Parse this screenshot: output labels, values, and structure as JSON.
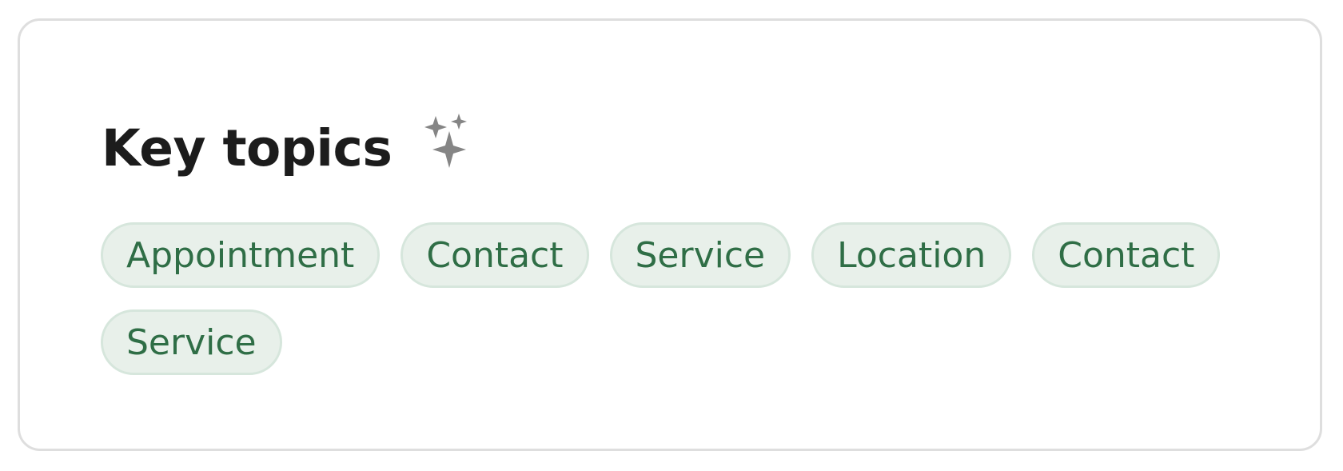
{
  "card": {
    "title": "Key topics",
    "title_icon": "sparkle-icon",
    "topics": [
      "Appointment",
      "Contact",
      "Service",
      "Location",
      "Contact",
      "Service"
    ]
  },
  "colors": {
    "title": "#1c1c1c",
    "icon": "#858585",
    "chip_background": "#e8f0ea",
    "chip_border": "#d6e6dc",
    "chip_text": "#2f6e46",
    "card_border": "#dedede"
  }
}
